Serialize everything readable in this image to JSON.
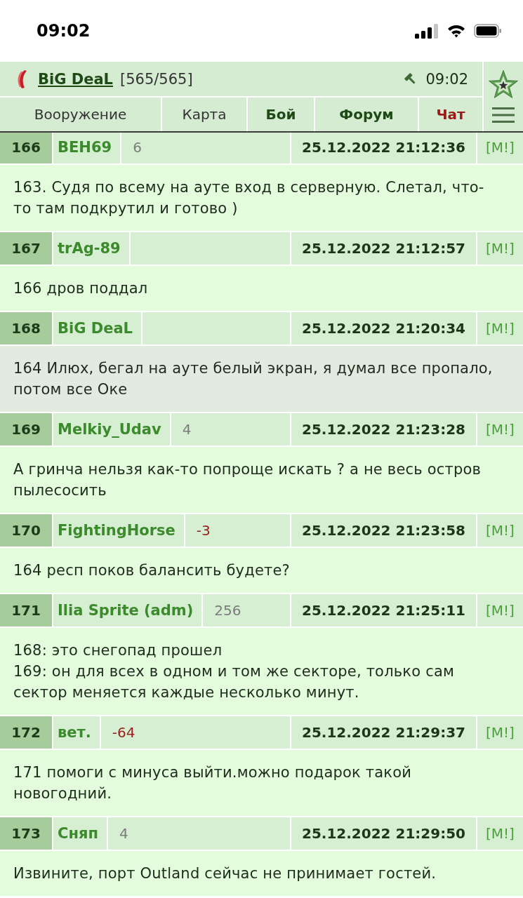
{
  "status_bar": {
    "time": "09:02"
  },
  "header": {
    "title": "BiG DeaL",
    "count": "[565/565]",
    "time": "09:02"
  },
  "tabs": [
    {
      "label": "Вооружение",
      "kind": "plain"
    },
    {
      "label": "Карта",
      "kind": "plain"
    },
    {
      "label": "Бой",
      "kind": "bold"
    },
    {
      "label": "Форум",
      "kind": "bold"
    },
    {
      "label": "Чат",
      "kind": "alert"
    }
  ],
  "posts": [
    {
      "number": "166",
      "author": "BEH69",
      "rating": {
        "value": "6",
        "negative": false
      },
      "date": "25.12.2022 21:12:36",
      "report": "[M!]",
      "text": "163. Судя по всему на ауте вход в серверную. Слетал, что-то там подкрутил и готово )",
      "highlighted": false
    },
    {
      "number": "167",
      "author": "trAg-89",
      "date": "25.12.2022 21:12:57",
      "report": "[M!]",
      "text": "166 дров поддал",
      "highlighted": false
    },
    {
      "number": "168",
      "author": "BiG DeaL",
      "date": "25.12.2022 21:20:34",
      "report": "[M!]",
      "text": "164 Илюх, бегал на ауте белый экран, я думал все пропало, потом все Оке",
      "highlighted": true
    },
    {
      "number": "169",
      "author": "Melkiy_Udav",
      "rating": {
        "value": "4",
        "negative": false
      },
      "date": "25.12.2022 21:23:28",
      "report": "[M!]",
      "text": "А гринча нельзя как-то попроще искать ? а не весь остров пылесосить",
      "highlighted": false
    },
    {
      "number": "170",
      "author": "FightingHorse",
      "rating": {
        "value": "-3",
        "negative": true
      },
      "date": "25.12.2022 21:23:58",
      "report": "[M!]",
      "text": "164 респ поков балансить будете?",
      "highlighted": false
    },
    {
      "number": "171",
      "author": "Ilia Sprite (adm)",
      "rating": {
        "value": "256",
        "negative": false
      },
      "date": "25.12.2022 21:25:11",
      "report": "[M!]",
      "text": "168: это снегопад прошел\n169: он для всех в одном и том же секторе, только сам сектор меняется каждые несколько минут.",
      "highlighted": false
    },
    {
      "number": "172",
      "author": "вет.",
      "rating": {
        "value": "-64",
        "negative": true
      },
      "date": "25.12.2022 21:29:37",
      "report": "[M!]",
      "text": "171 помоги с минуса выйти.можно подарок такой новогодний.",
      "highlighted": false
    },
    {
      "number": "173",
      "author": "Сняп",
      "rating": {
        "value": "4",
        "negative": false
      },
      "date": "25.12.2022 21:29:50",
      "report": "[M!]",
      "text": "Извините, порт Outland сейчас не принимает гостей.",
      "highlighted": false
    }
  ]
}
